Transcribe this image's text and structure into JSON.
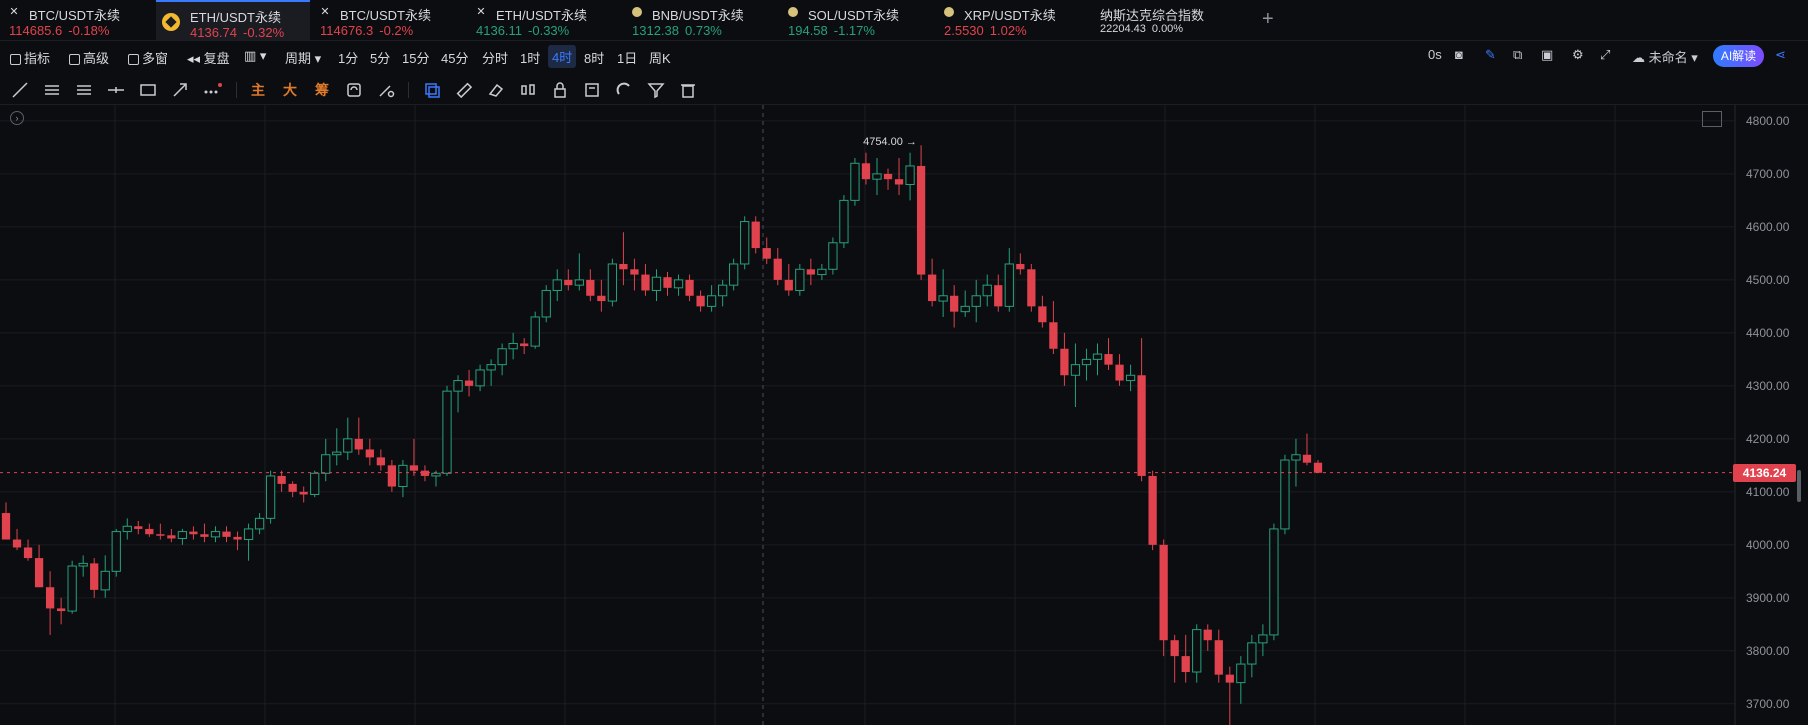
{
  "tabs": [
    {
      "name": "BTC/USDT永续",
      "price": "114685.6",
      "change": "-0.18%",
      "dir": "down",
      "icon": "x-icon"
    },
    {
      "name": "ETH/USDT永续",
      "price": "4136.74",
      "change": "-0.32%",
      "dir": "down",
      "icon": "binance-icon",
      "active": true
    },
    {
      "name": "BTC/USDT永续",
      "price": "114676.3",
      "change": "-0.2%",
      "dir": "down",
      "icon": "x-icon"
    },
    {
      "name": "ETH/USDT永续",
      "price": "4136.11",
      "change": "-0.33%",
      "dir": "up",
      "icon": "x-icon"
    },
    {
      "name": "BNB/USDT永续",
      "price": "1312.38",
      "change": "0.73%",
      "dir": "up",
      "icon": "bnb-icon"
    },
    {
      "name": "SOL/USDT永续",
      "price": "194.58",
      "change": "-1.17%",
      "dir": "up",
      "icon": "sol-icon"
    },
    {
      "name": "XRP/USDT永续",
      "price": "2.5530",
      "change": "1.02%",
      "dir": "down",
      "icon": "xrp-icon"
    },
    {
      "name": "纳斯达克综合指数",
      "price": "22204.43",
      "change": "0.00%",
      "dir": "neutral",
      "icon": ""
    }
  ],
  "add_tab": "+",
  "toolbar": {
    "indicators": "指标",
    "advanced": "高级",
    "multi_window": "多窗",
    "replay": "复盘",
    "period_label": "周期",
    "periods": [
      "1分",
      "5分",
      "15分",
      "45分",
      "分时",
      "1时",
      "4时",
      "8时",
      "1日",
      "周K"
    ],
    "active_period": "4时",
    "countdown": "0s",
    "layout_name": "未命名",
    "ai_button": "AI解读"
  },
  "draw_tools": {
    "main": "主",
    "big": "大",
    "chip": "筹"
  },
  "colors": {
    "up": "#26a17b",
    "down": "#e0434e",
    "background": "#0c0d10",
    "accent": "#3a7afe"
  },
  "chart": {
    "current_price": "4136.24",
    "high_label": "4754.00 →",
    "y_ticks": [
      "4800.00",
      "4700.00",
      "4600.00",
      "4500.00",
      "4400.00",
      "4300.00",
      "4200.00",
      "4100.00",
      "4000.00",
      "3900.00",
      "3800.00",
      "3700.00"
    ]
  },
  "chart_data": {
    "type": "candlestick",
    "interval": "4时",
    "ylim": [
      3660,
      4830
    ],
    "current_price": 4136.24,
    "high": 4754.0,
    "candles": [
      [
        4060,
        4080,
        4030,
        4010
      ],
      [
        4010,
        4030,
        3990,
        3995
      ],
      [
        3995,
        4010,
        3970,
        3975
      ],
      [
        3975,
        4000,
        3920,
        3920
      ],
      [
        3920,
        3950,
        3830,
        3880
      ],
      [
        3880,
        3900,
        3850,
        3875
      ],
      [
        3875,
        3970,
        3870,
        3960
      ],
      [
        3960,
        3980,
        3940,
        3965
      ],
      [
        3965,
        3975,
        3900,
        3915
      ],
      [
        3915,
        3980,
        3900,
        3950
      ],
      [
        3950,
        4030,
        3940,
        4025
      ],
      [
        4025,
        4050,
        4010,
        4035
      ],
      [
        4035,
        4045,
        4020,
        4030
      ],
      [
        4030,
        4040,
        4015,
        4020
      ],
      [
        4020,
        4040,
        4010,
        4018
      ],
      [
        4018,
        4030,
        4005,
        4012
      ],
      [
        4012,
        4030,
        4000,
        4025
      ],
      [
        4025,
        4035,
        4010,
        4020
      ],
      [
        4020,
        4040,
        4005,
        4015
      ],
      [
        4015,
        4035,
        4005,
        4025
      ],
      [
        4025,
        4035,
        4005,
        4015
      ],
      [
        4015,
        4025,
        3990,
        4010
      ],
      [
        4010,
        4040,
        3970,
        4030
      ],
      [
        4030,
        4060,
        4020,
        4050
      ],
      [
        4050,
        4140,
        4040,
        4130
      ],
      [
        4130,
        4140,
        4100,
        4115
      ],
      [
        4115,
        4120,
        4090,
        4100
      ],
      [
        4100,
        4110,
        4080,
        4095
      ],
      [
        4095,
        4140,
        4090,
        4135
      ],
      [
        4135,
        4200,
        4120,
        4170
      ],
      [
        4170,
        4220,
        4150,
        4175
      ],
      [
        4175,
        4240,
        4160,
        4200
      ],
      [
        4200,
        4240,
        4170,
        4180
      ],
      [
        4180,
        4200,
        4150,
        4165
      ],
      [
        4165,
        4180,
        4140,
        4150
      ],
      [
        4150,
        4160,
        4100,
        4110
      ],
      [
        4110,
        4160,
        4090,
        4150
      ],
      [
        4150,
        4200,
        4130,
        4140
      ],
      [
        4140,
        4150,
        4120,
        4130
      ],
      [
        4130,
        4140,
        4110,
        4135
      ],
      [
        4135,
        4300,
        4130,
        4290
      ],
      [
        4290,
        4320,
        4250,
        4310
      ],
      [
        4310,
        4330,
        4280,
        4300
      ],
      [
        4300,
        4340,
        4290,
        4330
      ],
      [
        4330,
        4350,
        4300,
        4340
      ],
      [
        4340,
        4380,
        4320,
        4370
      ],
      [
        4370,
        4400,
        4350,
        4380
      ],
      [
        4380,
        4390,
        4360,
        4375
      ],
      [
        4375,
        4440,
        4370,
        4430
      ],
      [
        4430,
        4490,
        4420,
        4480
      ],
      [
        4480,
        4520,
        4460,
        4500
      ],
      [
        4500,
        4520,
        4480,
        4490
      ],
      [
        4490,
        4550,
        4480,
        4500
      ],
      [
        4500,
        4520,
        4460,
        4470
      ],
      [
        4470,
        4500,
        4440,
        4460
      ],
      [
        4460,
        4540,
        4450,
        4530
      ],
      [
        4530,
        4590,
        4490,
        4520
      ],
      [
        4520,
        4540,
        4480,
        4510
      ],
      [
        4510,
        4530,
        4470,
        4480
      ],
      [
        4480,
        4520,
        4460,
        4505
      ],
      [
        4505,
        4515,
        4470,
        4485
      ],
      [
        4485,
        4510,
        4470,
        4500
      ],
      [
        4500,
        4510,
        4460,
        4470
      ],
      [
        4470,
        4480,
        4440,
        4450
      ],
      [
        4450,
        4490,
        4440,
        4470
      ],
      [
        4470,
        4500,
        4450,
        4490
      ],
      [
        4490,
        4540,
        4480,
        4530
      ],
      [
        4530,
        4620,
        4520,
        4610
      ],
      [
        4610,
        4620,
        4550,
        4560
      ],
      [
        4560,
        4580,
        4530,
        4540
      ],
      [
        4540,
        4560,
        4490,
        4500
      ],
      [
        4500,
        4530,
        4470,
        4480
      ],
      [
        4480,
        4530,
        4470,
        4520
      ],
      [
        4520,
        4540,
        4490,
        4510
      ],
      [
        4510,
        4530,
        4500,
        4520
      ],
      [
        4520,
        4580,
        4510,
        4570
      ],
      [
        4570,
        4660,
        4560,
        4650
      ],
      [
        4650,
        4730,
        4640,
        4720
      ],
      [
        4720,
        4740,
        4680,
        4690
      ],
      [
        4690,
        4730,
        4660,
        4700
      ],
      [
        4700,
        4710,
        4670,
        4690
      ],
      [
        4690,
        4730,
        4660,
        4680
      ],
      [
        4680,
        4740,
        4650,
        4715
      ],
      [
        4715,
        4754,
        4500,
        4510
      ],
      [
        4510,
        4540,
        4450,
        4460
      ],
      [
        4460,
        4520,
        4430,
        4470
      ],
      [
        4470,
        4490,
        4410,
        4440
      ],
      [
        4440,
        4480,
        4430,
        4450
      ],
      [
        4450,
        4500,
        4420,
        4470
      ],
      [
        4470,
        4510,
        4450,
        4490
      ],
      [
        4490,
        4510,
        4440,
        4450
      ],
      [
        4450,
        4560,
        4440,
        4530
      ],
      [
        4530,
        4550,
        4510,
        4520
      ],
      [
        4520,
        4530,
        4440,
        4450
      ],
      [
        4450,
        4470,
        4410,
        4420
      ],
      [
        4420,
        4460,
        4360,
        4370
      ],
      [
        4370,
        4400,
        4300,
        4320
      ],
      [
        4320,
        4380,
        4260,
        4340
      ],
      [
        4340,
        4370,
        4310,
        4350
      ],
      [
        4350,
        4380,
        4320,
        4360
      ],
      [
        4360,
        4390,
        4330,
        4340
      ],
      [
        4340,
        4360,
        4300,
        4310
      ],
      [
        4310,
        4340,
        4290,
        4320
      ],
      [
        4320,
        4390,
        4120,
        4130
      ],
      [
        4130,
        4140,
        3990,
        4000
      ],
      [
        4000,
        4010,
        3790,
        3820
      ],
      [
        3820,
        3830,
        3740,
        3790
      ],
      [
        3790,
        3830,
        3740,
        3760
      ],
      [
        3760,
        3850,
        3740,
        3840
      ],
      [
        3840,
        3850,
        3800,
        3820
      ],
      [
        3820,
        3840,
        3740,
        3755
      ],
      [
        3755,
        3770,
        3660,
        3740
      ],
      [
        3740,
        3790,
        3700,
        3775
      ],
      [
        3775,
        3830,
        3750,
        3815
      ],
      [
        3815,
        3850,
        3790,
        3830
      ],
      [
        3830,
        4040,
        3820,
        4030
      ],
      [
        4030,
        4170,
        4020,
        4160
      ],
      [
        4160,
        4200,
        4110,
        4170
      ],
      [
        4170,
        4210,
        4150,
        4155
      ],
      [
        4155,
        4160,
        4136,
        4136
      ]
    ]
  }
}
